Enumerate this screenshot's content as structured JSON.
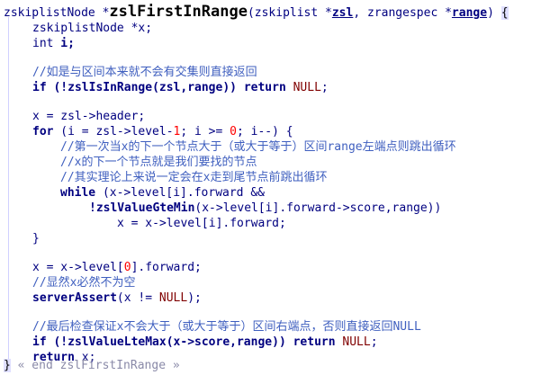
{
  "signature": {
    "ret": "zskiplistNode *",
    "name": "zslFirstInRange",
    "open": "(",
    "p1_type": "zskiplist *",
    "p1": "zsl",
    "sep": ", ",
    "p2_type": "zrangespec *",
    "p2": "range",
    "close": ") ",
    "brace": "{"
  },
  "lines": {
    "l2": "zskiplistNode *x;",
    "l3_kw": "int",
    "l3_rest": " i;",
    "c1": "//如是与区间本来就不会有交集则直接返回",
    "l6_kw": "if",
    "l6_a": " (!",
    "l6_fn": "zslIsInRange",
    "l6_b": "(zsl,range)) ",
    "l6_kw2": "return",
    "l6_sp": " ",
    "l6_c": "NULL",
    "l6_d": ";",
    "l8": "x = zsl->header;",
    "l9_kw": "for",
    "l9_a": " (i = zsl->level-",
    "l9_n1": "1",
    "l9_b": "; i >= ",
    "l9_n2": "0",
    "l9_c": "; i--) {",
    "c2": "//第一次当x的下一个节点大于（或大于等于）区间range左端点则跳出循环",
    "c3": "//x的下一个节点就是我们要找的节点",
    "c4": "//其实理论上来说一定会在x走到尾节点前跳出循环",
    "l13_kw": "while",
    "l13_rest": " (x->level[i].forward &&",
    "l14_a": "!",
    "l14_fn": "zslValueGteMin",
    "l14_b": "(x->level[i].forward->score,range))",
    "l15": "x = x->level[i].forward;",
    "l16": "}",
    "l18_a": "x = x->level[",
    "l18_n": "0",
    "l18_b": "].forward;",
    "c5": "//显然x必然不为空",
    "l20_fn": "serverAssert",
    "l20_a": "(x != ",
    "l20_c": "NULL",
    "l20_b": ");",
    "c6": "//最后检查保证x不会大于（或大于等于）区间右端点，否则直接返回NULL",
    "l23_kw": "if",
    "l23_a": " (!",
    "l23_fn": "zslValueLteMax",
    "l23_b": "(x->score,range)) ",
    "l23_kw2": "return",
    "l23_sp": " ",
    "l23_c": "NULL",
    "l23_d": ";",
    "l24_kw": "return",
    "l24_rest": " x;",
    "end_brace": "}",
    "end_tag": " « end zslFirstInRange »"
  }
}
